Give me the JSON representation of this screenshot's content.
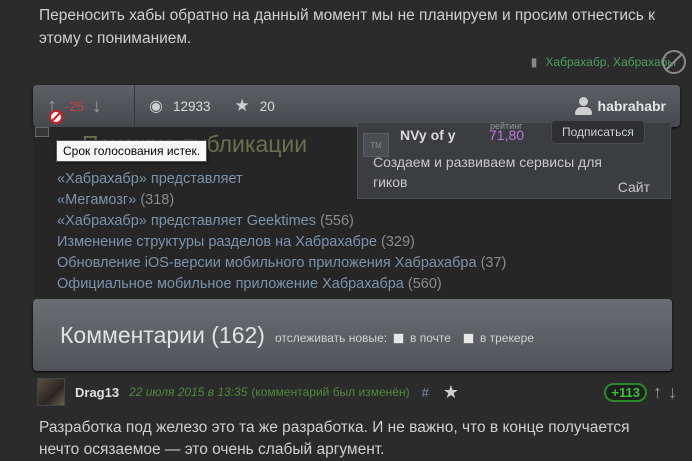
{
  "article": {
    "text": "Переносить хабы обратно на данный момент мы не планируем и просим отнестись к этому с пониманием.",
    "hubs": "Хабрахабр, Хабрахабы"
  },
  "infopanel": {
    "score": "-25",
    "views": "12933",
    "favorites": "20",
    "author": "habrahabr"
  },
  "tooltip": "Срок голосования истек.",
  "related": {
    "title": "Похожие публикации",
    "items": [
      {
        "label": "«Хабрахабр» представляет",
        "count": ""
      },
      {
        "label": "«Мегамозг»",
        "count": "(318)"
      },
      {
        "label": "«Хабрахабр» представляет Geektimes",
        "count": "(556)"
      },
      {
        "label": "Изменение структуры разделов на Хабрахабре",
        "count": "(329)"
      },
      {
        "label": "Обновление iOS-версии мобильного приложения Хабрахабра",
        "count": "(37)"
      },
      {
        "label": "Официальное мобильное приложение Хабрахабра",
        "count": "(560)"
      }
    ]
  },
  "author_card": {
    "logo": "TM",
    "name": "NVy of y",
    "rating_label": "рейтинг",
    "rating": "71,80",
    "subscribe": "Подписаться",
    "description": "Создаем и развиваем сервисы для гиков",
    "site": "Сайт"
  },
  "comments": {
    "title": "Комментарии (162)",
    "track_label": "отслеживать новые:",
    "option_mail": "в почте",
    "option_tracker": "в трекере"
  },
  "comment": {
    "username": "Drag13",
    "date": "22 июля 2015 в 13:35",
    "edited": "(комментарий был изменён)",
    "hash": "#",
    "score": "+113",
    "text": "Разработка под железо это та же разработка. И не важно, что в конце получается нечто осязаемое — это очень слабый аргумент."
  }
}
